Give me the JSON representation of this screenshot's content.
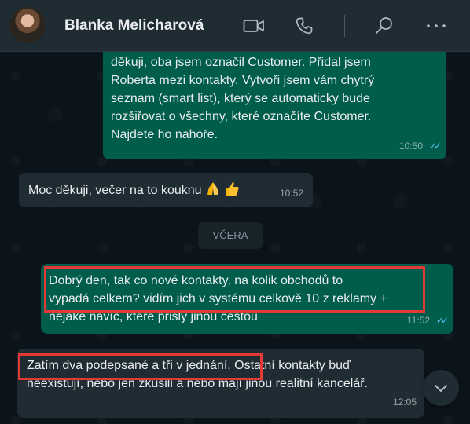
{
  "header": {
    "contact_name": "Blanka Melicharová",
    "icons": [
      "video-call-icon",
      "voice-call-icon",
      "search-icon",
      "menu-icon"
    ]
  },
  "messages": [
    {
      "direction": "outgoing",
      "lines": [
        "děkuji, oba jsem označil Customer. Přidal jsem",
        "Roberta mezi kontakty. Vytvoři jsem vám chytrý",
        "seznam (smart list), který se automaticky bude",
        "rozšiřovat o všechny, které označíte Customer.",
        "Najdete ho nahoře."
      ],
      "time": "10:50",
      "status": "read"
    },
    {
      "direction": "incoming",
      "text": "Moc děkuji, večer na to kouknu",
      "emojis": [
        "folded-hands-emoji",
        "thumbs-up-emoji"
      ],
      "time": "10:52"
    },
    {
      "direction": "outgoing",
      "lines": [
        "Dobrý den, tak co nové kontakty, na kolik obchodů to",
        "vypadá celkem? vidím jich v systému celkově 10 z reklamy +",
        "nějaké navíc, které přišly jinou cestou"
      ],
      "time": "11:52",
      "status": "read"
    },
    {
      "direction": "incoming",
      "line1_highlighted": "Zatím dva podepsané a tři v jednání.",
      "line1_rest": " Ostatní kontakty buď",
      "line2": "neexistují, nebo jen zkusili a nebo mají jinou realitní kancelář.",
      "time": "12:05"
    }
  ],
  "day_separator": "VČERA",
  "colors": {
    "outgoing_bubble": "#005c4b",
    "incoming_bubble": "#202c33",
    "read_ticks": "#53bdeb",
    "highlight_box": "#e53935"
  }
}
